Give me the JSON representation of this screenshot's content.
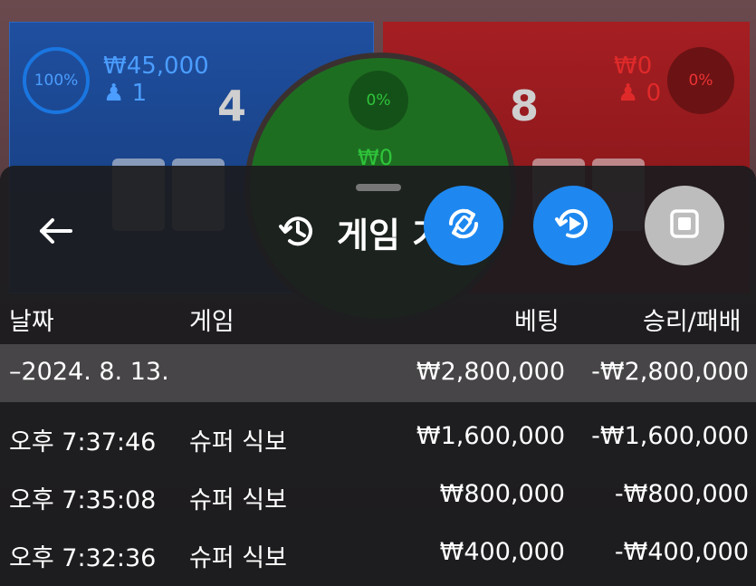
{
  "board": {
    "player": {
      "percent": "100%",
      "amount": "₩45,000",
      "bettors": "1",
      "score": "4"
    },
    "banker": {
      "percent": "0%",
      "amount": "₩0",
      "bettors": "0",
      "score": "8"
    },
    "tie": {
      "percent": "0%",
      "amount": "₩0"
    }
  },
  "sheet": {
    "title": "게임 기록",
    "columns": {
      "date": "날짜",
      "game": "게임",
      "bet": "베팅",
      "winloss": "승리/패배"
    },
    "summary": {
      "date": "–2024. 8. 13.",
      "bet": "₩2,800,000",
      "winloss": "-₩2,800,000"
    },
    "rows": [
      {
        "time": "오후 7:37:46",
        "game": "슈퍼 식보",
        "bet": "₩1,600,000",
        "winloss": "-₩1,600,000"
      },
      {
        "time": "오후 7:35:08",
        "game": "슈퍼 식보",
        "bet": "₩800,000",
        "winloss": "-₩800,000"
      },
      {
        "time": "오후 7:32:36",
        "game": "슈퍼 식보",
        "bet": "₩400,000",
        "winloss": "-₩400,000"
      }
    ]
  },
  "icons": {
    "back": "arrow-left-icon",
    "history": "history-icon",
    "auto": "auto-rotate-icon",
    "replay": "replay-icon",
    "stop": "stop-icon"
  },
  "colors": {
    "accent": "#1e88f0",
    "player": "#1f4f9f",
    "banker": "#a51e22",
    "tie": "#1e6e22"
  }
}
